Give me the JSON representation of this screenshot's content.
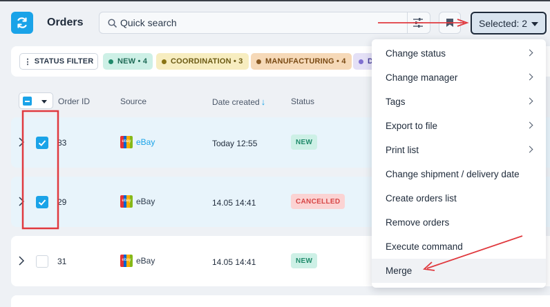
{
  "header": {
    "title": "Orders",
    "search": {
      "placeholder": "Quick search"
    },
    "selected_button": "Selected: 2"
  },
  "filters": {
    "status_filter_label": "STATUS FILTER",
    "chips": [
      {
        "label": "NEW • 4",
        "bg": "#cdf0e6",
        "fg": "#1f6b57",
        "dot": "#1f8a6a"
      },
      {
        "label": "COORDINATION • 3",
        "bg": "#f7edc0",
        "fg": "#6b5a14",
        "dot": "#8a7414"
      },
      {
        "label": "MANUFACTURING • 4",
        "bg": "#f6d9b8",
        "fg": "#7a4a14",
        "dot": "#8a5a24"
      },
      {
        "label": "D",
        "bg": "#e4e0f6",
        "fg": "#4a3f9a",
        "dot": "#7f6fd0"
      }
    ]
  },
  "table": {
    "columns": {
      "order_id": "Order ID",
      "source": "Source",
      "date_created": "Date created",
      "status": "Status"
    },
    "rows": [
      {
        "order_id": "83",
        "source": "eBay",
        "date": "Today 12:55",
        "status": "NEW",
        "selected": true
      },
      {
        "order_id": "29",
        "source": "eBay",
        "date": "14.05 14:41",
        "status": "CANCELLED",
        "selected": true
      },
      {
        "order_id": "31",
        "source": "eBay",
        "date": "14.05 14:41",
        "status": "NEW",
        "selected": false
      }
    ]
  },
  "menu": {
    "items": [
      {
        "label": "Change status",
        "submenu": true
      },
      {
        "label": "Change manager",
        "submenu": true
      },
      {
        "label": "Tags",
        "submenu": true
      },
      {
        "label": "Export to file",
        "submenu": true
      },
      {
        "label": "Print list",
        "submenu": true
      },
      {
        "label": "Change shipment / delivery date",
        "submenu": false
      },
      {
        "label": "Create orders list",
        "submenu": false
      },
      {
        "label": "Remove orders",
        "submenu": false
      },
      {
        "label": "Execute command",
        "submenu": false
      },
      {
        "label": "Merge",
        "submenu": false,
        "highlighted": true
      }
    ]
  },
  "colors": {
    "accent": "#1aa3e8",
    "annotation": "#e0393e"
  }
}
